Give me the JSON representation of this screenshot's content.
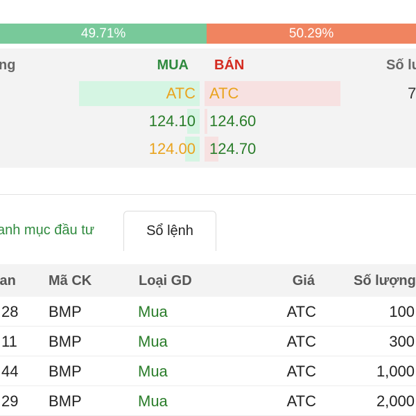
{
  "ratio": {
    "buy_pct": 49.71,
    "buy_label": "49.71%",
    "sell_pct": 50.29,
    "sell_label": "50.29%",
    "buy_color": "#78c99a",
    "sell_color": "#f08460"
  },
  "order_book": {
    "headers": {
      "left": "ng",
      "buy": "MUA",
      "sell": "BÁN",
      "right": "Số lư"
    },
    "rows": [
      {
        "buy_price": "ATC",
        "buy_color": "orange",
        "buy_fill": 0.98,
        "sell_price": "ATC",
        "sell_color": "orange",
        "sell_fill": 1.0,
        "right_value": "7"
      },
      {
        "buy_price": "124.10",
        "buy_color": "green",
        "buy_fill": 0.1,
        "sell_price": "124.60",
        "sell_color": "green",
        "sell_fill": 0.02,
        "right_value": ""
      },
      {
        "buy_price": "124.00",
        "buy_color": "orange",
        "buy_fill": 0.12,
        "sell_price": "124.70",
        "sell_color": "green",
        "sell_fill": 0.1,
        "right_value": ""
      }
    ]
  },
  "tabs": [
    {
      "label": "anh mục đầu tư",
      "active": false
    },
    {
      "label": "Sổ lệnh",
      "active": true
    }
  ],
  "orders_table": {
    "headers": [
      "ian",
      "Mã CK",
      "Loại GD",
      "Giá",
      "Số lượng"
    ],
    "rows": [
      {
        "time": "28",
        "code": "BMP",
        "type": "Mua",
        "price": "ATC",
        "qty": "100"
      },
      {
        "time": "11",
        "code": "BMP",
        "type": "Mua",
        "price": "ATC",
        "qty": "300"
      },
      {
        "time": "44",
        "code": "BMP",
        "type": "Mua",
        "price": "ATC",
        "qty": "1,000"
      },
      {
        "time": "29",
        "code": "BMP",
        "type": "Mua",
        "price": "ATC",
        "qty": "2,000"
      }
    ]
  }
}
